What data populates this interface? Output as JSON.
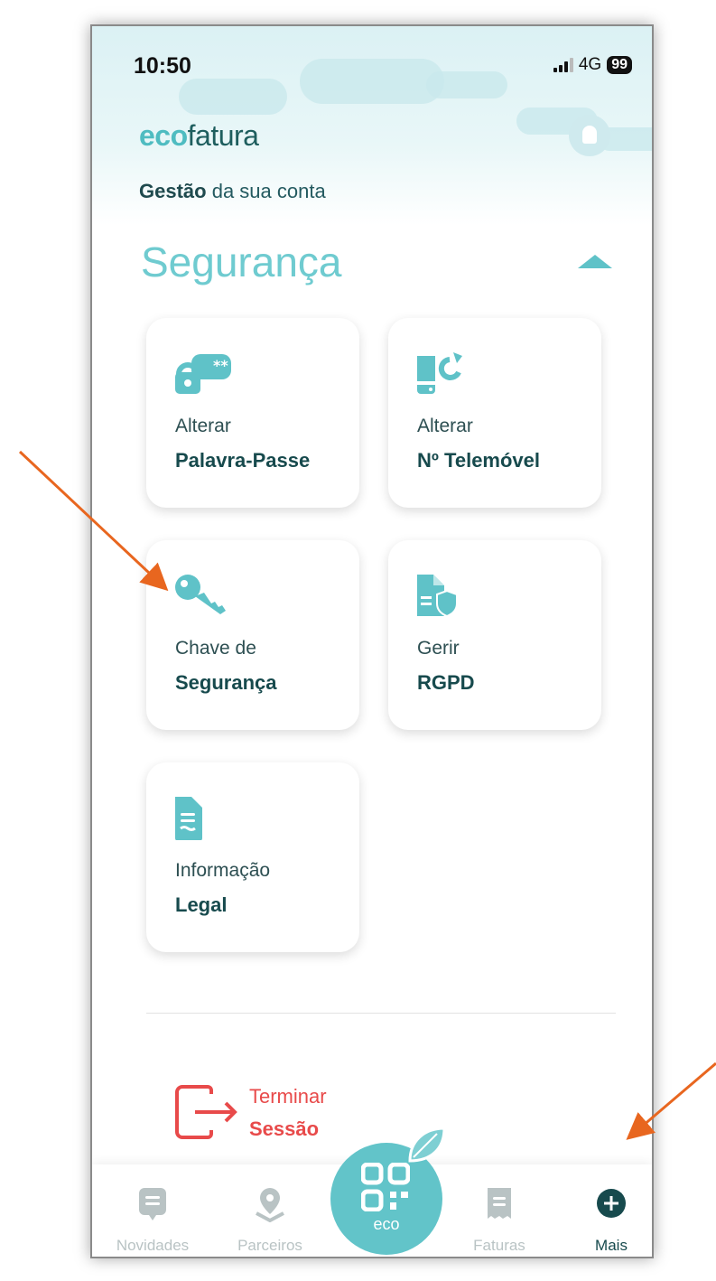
{
  "status_bar": {
    "time": "10:50",
    "network": "4G",
    "battery": "99"
  },
  "header": {
    "logo_eco": "eco",
    "logo_rest": "fatura",
    "subtitle_bold": "Gestão",
    "subtitle_rest": "da sua conta"
  },
  "section": {
    "title": "Segurança"
  },
  "cards": [
    {
      "line1": "Alterar",
      "line2": "Palavra-Passe",
      "icon": "lock-password-icon"
    },
    {
      "line1": "Alterar",
      "line2": "Nº Telemóvel",
      "icon": "phone-refresh-icon"
    },
    {
      "line1": "Chave de",
      "line2": "Segurança",
      "icon": "key-icon"
    },
    {
      "line1": "Gerir",
      "line2": "RGPD",
      "icon": "document-shield-icon"
    },
    {
      "line1": "Informação",
      "line2": "Legal",
      "icon": "legal-document-icon"
    }
  ],
  "logout": {
    "line1": "Terminar",
    "line2": "Sessão"
  },
  "tabbar": {
    "items": [
      {
        "label": "Novidades",
        "icon": "news-icon"
      },
      {
        "label": "Parceiros",
        "icon": "location-pin-icon"
      },
      {
        "label": "Faturas",
        "icon": "receipt-icon"
      },
      {
        "label": "Mais",
        "icon": "plus-circle-icon"
      }
    ],
    "center_label": "eco"
  },
  "colors": {
    "accent": "#62c4c9",
    "dark_text": "#174a4d",
    "logout": "#e84a4a",
    "annotation_arrow": "#e8661f"
  }
}
